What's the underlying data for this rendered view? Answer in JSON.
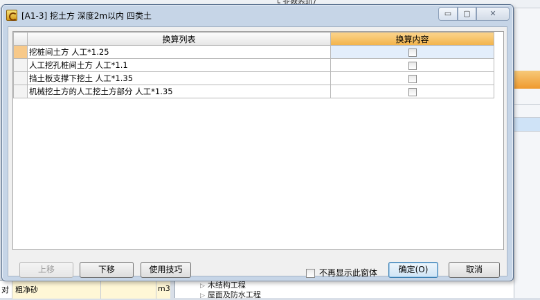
{
  "background": {
    "top_fragment": "└ 北然乔扒/",
    "bottom_left_row": {
      "col1": "对",
      "col2": "粗净砂",
      "col3": "",
      "col4": "m3"
    },
    "tree_nodes": [
      "木结构工程",
      "屋面及防水工程"
    ]
  },
  "dialog": {
    "title": "[A1-3]  挖土方 深度2m以内 四类土",
    "sys_buttons": {
      "minimize": "▭",
      "maximize": "▢",
      "close": "✕"
    },
    "grid": {
      "columns": [
        "换算列表",
        "换算内容"
      ],
      "rows": [
        {
          "name": "挖桩间土方 人工*1.25",
          "checked": false,
          "selected": true
        },
        {
          "name": "人工挖孔桩间土方 人工*1.1",
          "checked": false,
          "selected": false
        },
        {
          "name": "挡土板支撑下挖土 人工*1.35",
          "checked": false,
          "selected": false
        },
        {
          "name": "机械挖土方的人工挖土方部分 人工*1.35",
          "checked": false,
          "selected": false
        }
      ]
    },
    "buttons": {
      "move_up": "上移",
      "move_down": "下移",
      "tips": "使用技巧",
      "ok": "确定(O)",
      "cancel": "取消"
    },
    "dont_show_label": "不再显示此窗体",
    "colors": {
      "active_header": "#f2b34a",
      "selected_indicator": "#f7c98a",
      "selected_row": "#e3eefb"
    }
  }
}
